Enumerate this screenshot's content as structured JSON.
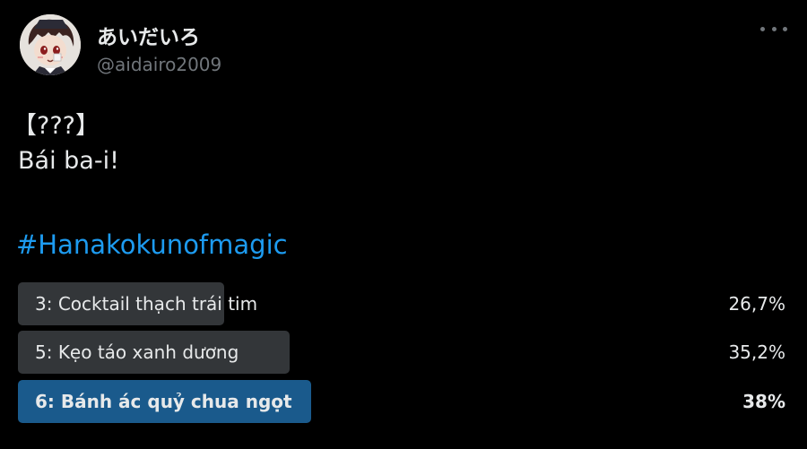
{
  "author": {
    "display_name": "あいだいろ",
    "handle": "@aidairo2009",
    "avatar_icon": "avatar-icon"
  },
  "more_icon": "more-options-icon",
  "tweet": {
    "line1": "【???】",
    "line2": "Bái ba-i!",
    "hashtag": "#Hanakokunofmagic"
  },
  "poll": {
    "options": [
      {
        "label": "3: Cocktail thạch trái tim",
        "percent_text": "26,7%",
        "percent": 26.7,
        "winner": false
      },
      {
        "label": "5: Kẹo táo xanh dương",
        "percent_text": "35,2%",
        "percent": 35.2,
        "winner": false
      },
      {
        "label": "6: Bánh ác quỷ chua ngọt",
        "percent_text": "38%",
        "percent": 38,
        "winner": true
      }
    ]
  },
  "colors": {
    "background": "#000000",
    "text": "#e7e9ea",
    "muted": "#71767b",
    "link": "#1d9bf0",
    "poll_bar": "#333639",
    "poll_bar_winner": "#1a5a8c"
  }
}
